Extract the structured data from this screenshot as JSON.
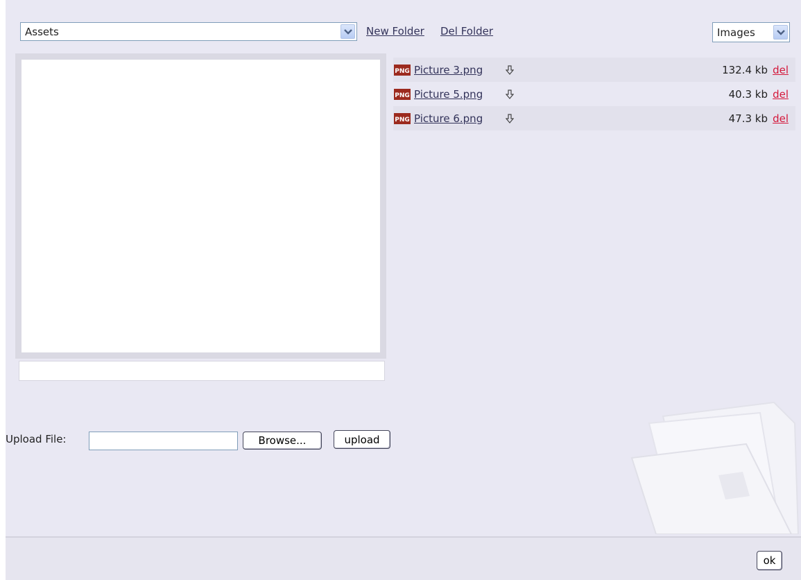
{
  "folder_select": {
    "value": "Assets"
  },
  "toolbar": {
    "new_folder": "New Folder",
    "del_folder": "Del Folder"
  },
  "type_select": {
    "value": "Images"
  },
  "files": [
    {
      "name": "Picture 3.png",
      "size": "132.4 kb",
      "delete": "del",
      "icon": "png-file-icon"
    },
    {
      "name": "Picture 5.png",
      "size": "40.3 kb",
      "delete": "del",
      "icon": "png-file-icon"
    },
    {
      "name": "Picture 6.png",
      "size": "47.3 kb",
      "delete": "del",
      "icon": "png-file-icon"
    }
  ],
  "upload": {
    "label": "Upload File:",
    "value": "",
    "browse_label": "Browse...",
    "upload_label": "upload"
  },
  "footer": {
    "ok_label": "ok"
  },
  "colors": {
    "background": "#e9e8f3",
    "link": "#33335a",
    "delete_link": "#d4173a"
  }
}
